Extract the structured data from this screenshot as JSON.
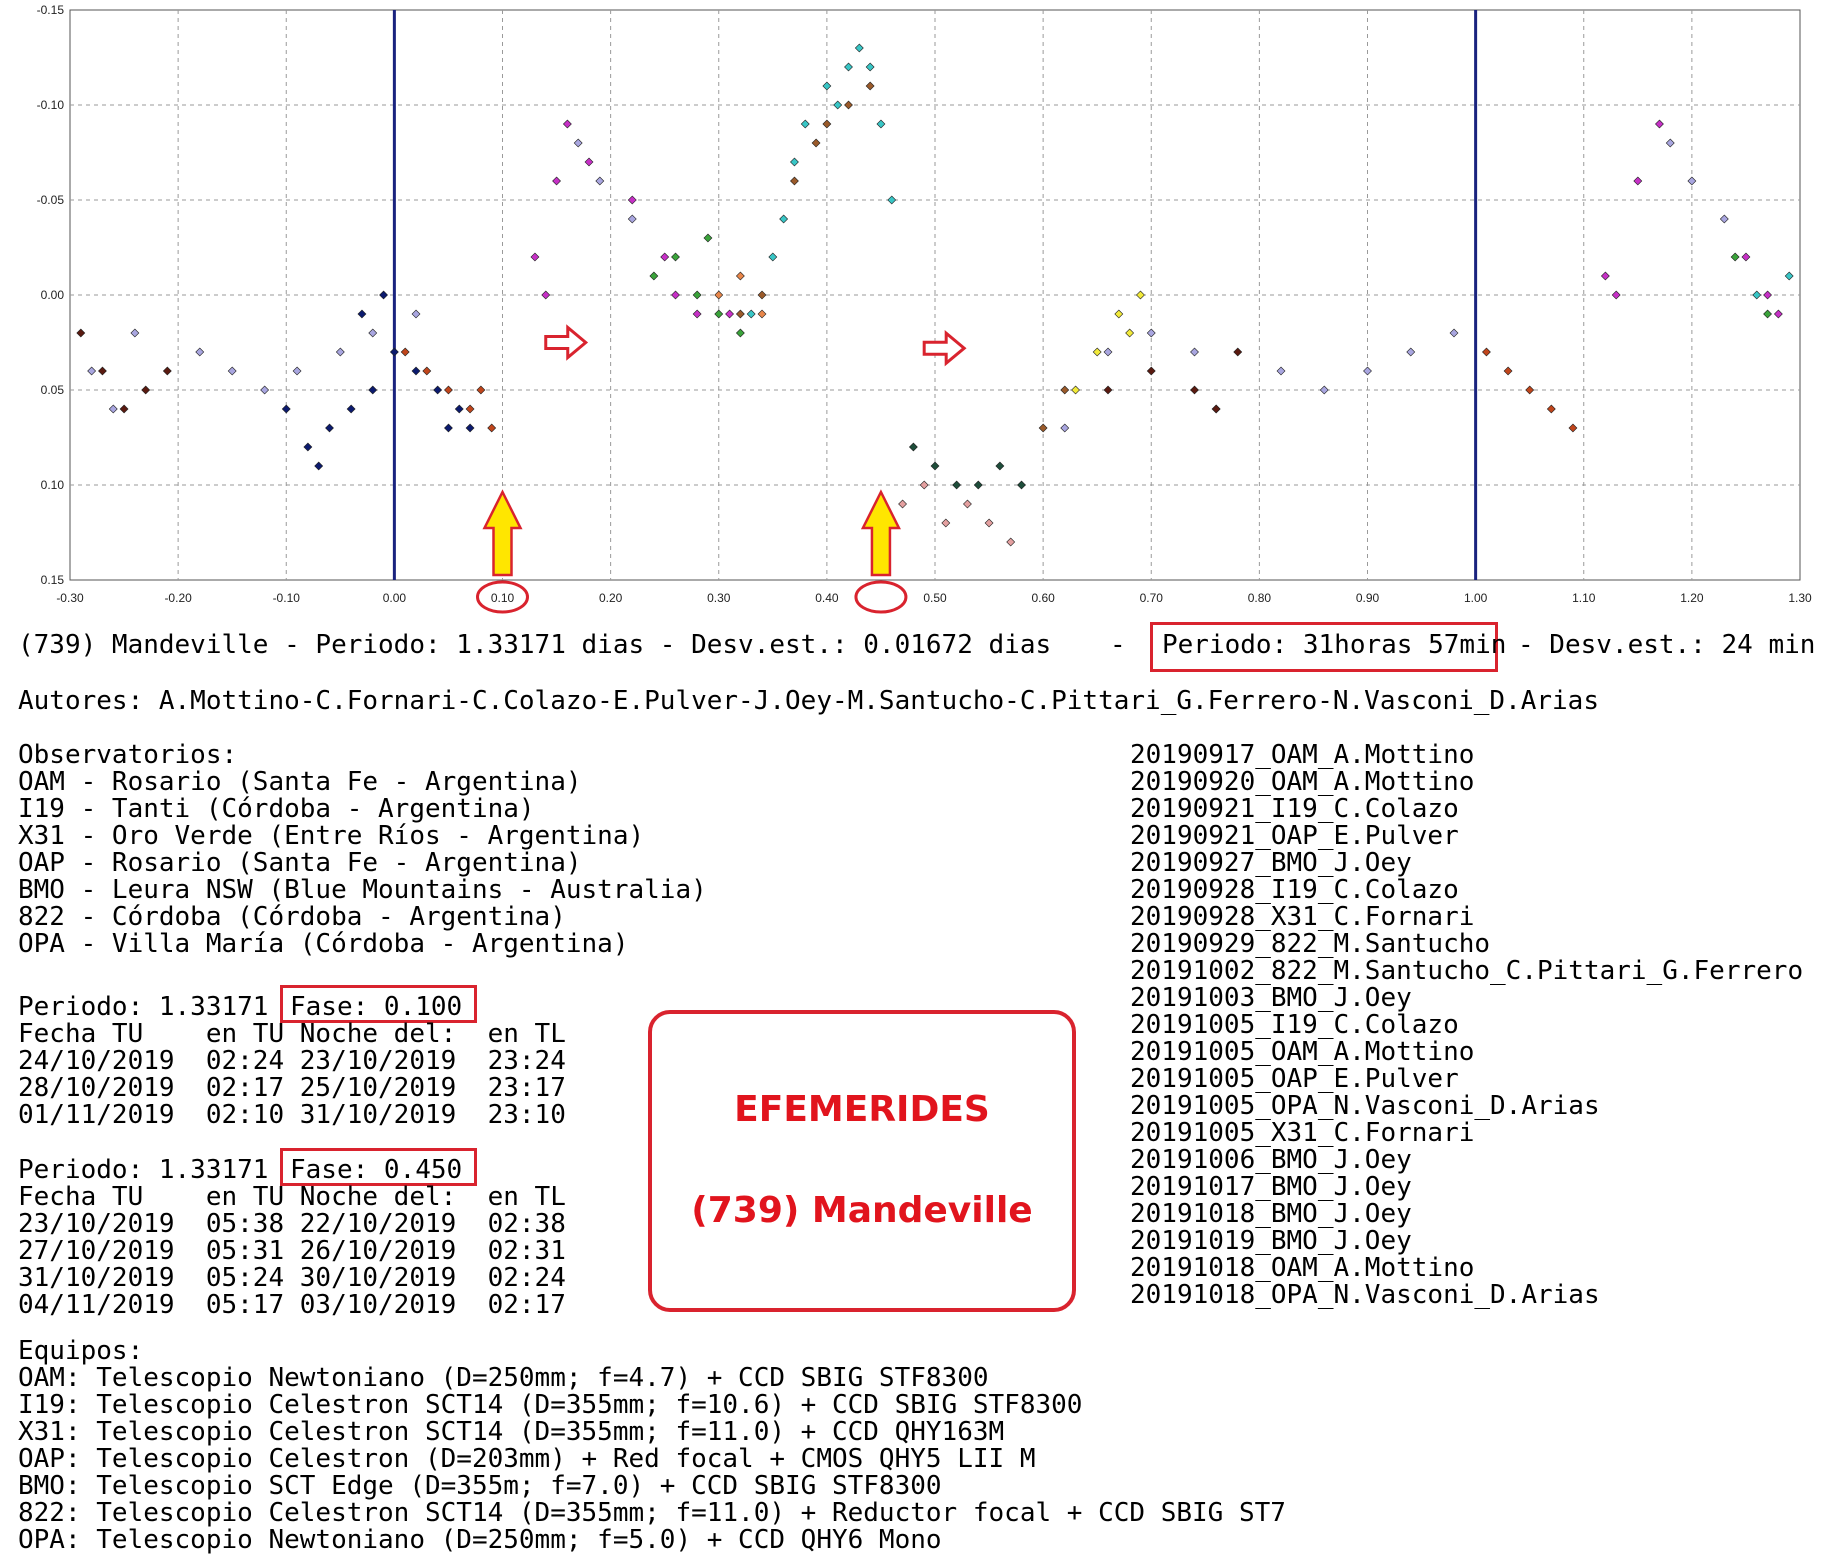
{
  "chart_data": {
    "type": "scatter",
    "title": "",
    "xlabel": "",
    "ylabel": "",
    "xlim": [
      -0.3,
      1.3
    ],
    "ylim": [
      -0.15,
      0.15
    ],
    "y_inverted": true,
    "grid": true,
    "x_tick_labels": [
      "-0.30",
      "-0.20",
      "-0.10",
      "0.00",
      "0.10",
      "0.20",
      "0.30",
      "0.40",
      "0.50",
      "0.60",
      "0.70",
      "0.80",
      "0.90",
      "1.00",
      "1.10",
      "1.20",
      "1.30"
    ],
    "y_tick_labels": [
      "-0.15",
      "-0.10",
      "-0.05",
      "0.00",
      "0.05",
      "0.10",
      "0.15"
    ],
    "x_tick_values": [
      -0.3,
      -0.2,
      -0.1,
      0.0,
      0.1,
      0.2,
      0.3,
      0.4,
      0.5,
      0.6,
      0.7,
      0.8,
      0.9,
      1.0,
      1.1,
      1.2,
      1.3
    ],
    "y_tick_values": [
      -0.15,
      -0.1,
      -0.05,
      0.0,
      0.05,
      0.1,
      0.15
    ],
    "vertical_lines": [
      0.0,
      1.0
    ],
    "circled_ticks": [
      {
        "x": 0.1,
        "label": "0.10"
      },
      {
        "x": 0.45,
        "label": "0.45"
      }
    ],
    "yellow_arrows": [
      0.1,
      0.45
    ],
    "red_arrows": [
      {
        "x": 0.14,
        "y": 0.025
      },
      {
        "x": 0.49,
        "y": 0.028
      }
    ],
    "colors": {
      "navy": "#0b1a6e",
      "lavender": "#a9a6e0",
      "rust": "#c0451b",
      "maroon": "#5a1a10",
      "magenta": "#c630c6",
      "teal": "#38c6c6",
      "green": "#3aa33a",
      "darkgreen": "#1e4d3a",
      "pink": "#e4a0a0",
      "yellow": "#f2ea3a",
      "brown": "#9a5a2a",
      "orange": "#e8864a"
    },
    "series": [
      {
        "color": "navy",
        "points": [
          [
            -0.08,
            0.08
          ],
          [
            -0.06,
            0.07
          ],
          [
            -0.04,
            0.06
          ],
          [
            -0.02,
            0.05
          ],
          [
            0.0,
            0.03
          ],
          [
            0.02,
            0.04
          ],
          [
            0.04,
            0.05
          ],
          [
            0.05,
            0.07
          ],
          [
            -0.1,
            0.06
          ],
          [
            -0.07,
            0.09
          ],
          [
            -0.03,
            0.01
          ],
          [
            -0.01,
            0.0
          ],
          [
            0.06,
            0.06
          ],
          [
            0.07,
            0.07
          ]
        ]
      },
      {
        "color": "lavender",
        "points": [
          [
            -0.28,
            0.04
          ],
          [
            -0.26,
            0.06
          ],
          [
            -0.24,
            0.02
          ],
          [
            -0.18,
            0.03
          ],
          [
            -0.15,
            0.04
          ],
          [
            -0.12,
            0.05
          ],
          [
            -0.09,
            0.04
          ],
          [
            -0.05,
            0.03
          ],
          [
            -0.02,
            0.02
          ],
          [
            0.02,
            0.01
          ],
          [
            0.17,
            -0.08
          ],
          [
            0.19,
            -0.06
          ],
          [
            0.22,
            -0.04
          ],
          [
            0.62,
            0.07
          ],
          [
            0.66,
            0.03
          ],
          [
            0.7,
            0.02
          ],
          [
            0.74,
            0.03
          ],
          [
            0.76,
            0.06
          ],
          [
            0.82,
            0.04
          ],
          [
            0.86,
            0.05
          ],
          [
            0.9,
            0.04
          ],
          [
            0.94,
            0.03
          ],
          [
            0.98,
            0.02
          ],
          [
            1.18,
            -0.08
          ],
          [
            1.2,
            -0.06
          ],
          [
            1.23,
            -0.04
          ]
        ]
      },
      {
        "color": "rust",
        "points": [
          [
            0.01,
            0.03
          ],
          [
            0.03,
            0.04
          ],
          [
            0.05,
            0.05
          ],
          [
            0.07,
            0.06
          ],
          [
            0.08,
            0.05
          ],
          [
            0.09,
            0.07
          ],
          [
            1.01,
            0.03
          ],
          [
            1.03,
            0.04
          ],
          [
            1.05,
            0.05
          ],
          [
            1.07,
            0.06
          ],
          [
            1.09,
            0.07
          ]
        ]
      },
      {
        "color": "maroon",
        "points": [
          [
            -0.29,
            0.02
          ],
          [
            -0.27,
            0.04
          ],
          [
            -0.25,
            0.06
          ],
          [
            -0.23,
            0.05
          ],
          [
            -0.21,
            0.04
          ],
          [
            0.66,
            0.05
          ],
          [
            0.7,
            0.04
          ],
          [
            0.74,
            0.05
          ],
          [
            0.76,
            0.06
          ],
          [
            0.78,
            0.03
          ]
        ]
      },
      {
        "color": "magenta",
        "points": [
          [
            0.13,
            -0.02
          ],
          [
            0.14,
            0.0
          ],
          [
            0.15,
            -0.06
          ],
          [
            0.16,
            -0.09
          ],
          [
            0.18,
            -0.07
          ],
          [
            0.22,
            -0.05
          ],
          [
            0.25,
            -0.02
          ],
          [
            0.26,
            0.0
          ],
          [
            0.28,
            0.01
          ],
          [
            0.31,
            0.01
          ],
          [
            1.12,
            -0.01
          ],
          [
            1.13,
            0.0
          ],
          [
            1.15,
            -0.06
          ],
          [
            1.17,
            -0.09
          ],
          [
            1.25,
            -0.02
          ],
          [
            1.27,
            0.0
          ],
          [
            1.28,
            0.01
          ]
        ]
      },
      {
        "color": "teal",
        "points": [
          [
            0.36,
            -0.04
          ],
          [
            0.37,
            -0.07
          ],
          [
            0.38,
            -0.09
          ],
          [
            0.4,
            -0.11
          ],
          [
            0.41,
            -0.1
          ],
          [
            0.42,
            -0.12
          ],
          [
            0.43,
            -0.13
          ],
          [
            0.44,
            -0.12
          ],
          [
            0.45,
            -0.09
          ],
          [
            0.46,
            -0.05
          ],
          [
            0.33,
            0.01
          ],
          [
            0.35,
            -0.02
          ],
          [
            1.26,
            0.0
          ],
          [
            1.29,
            -0.01
          ]
        ]
      },
      {
        "color": "green",
        "points": [
          [
            0.24,
            -0.01
          ],
          [
            0.26,
            -0.02
          ],
          [
            0.28,
            0.0
          ],
          [
            0.3,
            0.01
          ],
          [
            0.32,
            0.02
          ],
          [
            0.29,
            -0.03
          ],
          [
            1.24,
            -0.02
          ],
          [
            1.27,
            0.01
          ]
        ]
      },
      {
        "color": "darkgreen",
        "points": [
          [
            0.48,
            0.08
          ],
          [
            0.5,
            0.09
          ],
          [
            0.52,
            0.1
          ],
          [
            0.54,
            0.1
          ],
          [
            0.56,
            0.09
          ],
          [
            0.58,
            0.1
          ]
        ]
      },
      {
        "color": "pink",
        "points": [
          [
            0.49,
            0.1
          ],
          [
            0.51,
            0.12
          ],
          [
            0.53,
            0.11
          ],
          [
            0.55,
            0.12
          ],
          [
            0.57,
            0.13
          ],
          [
            0.47,
            0.11
          ]
        ]
      },
      {
        "color": "yellow",
        "points": [
          [
            0.63,
            0.05
          ],
          [
            0.65,
            0.03
          ],
          [
            0.67,
            0.01
          ],
          [
            0.69,
            0.0
          ],
          [
            0.68,
            0.02
          ]
        ]
      },
      {
        "color": "brown",
        "points": [
          [
            0.37,
            -0.06
          ],
          [
            0.39,
            -0.08
          ],
          [
            0.4,
            -0.09
          ],
          [
            0.42,
            -0.1
          ],
          [
            0.44,
            -0.11
          ],
          [
            0.32,
            0.01
          ],
          [
            0.34,
            0.0
          ],
          [
            0.6,
            0.07
          ],
          [
            0.62,
            0.05
          ]
        ]
      },
      {
        "color": "orange",
        "points": [
          [
            0.3,
            0.0
          ],
          [
            0.32,
            -0.01
          ],
          [
            0.34,
            0.01
          ]
        ]
      }
    ]
  },
  "info": {
    "period_line": "(739) Mandeville - Periodo: 1.33171 dias - Desv.est.: 0.01672 dias",
    "period_dash": "-",
    "period_hours": "Periodo: 31horas 57min",
    "period_std": "- Desv.est.: 24 min",
    "authors": "Autores: A.Mottino-C.Fornari-C.Colazo-E.Pulver-J.Oey-M.Santucho-C.Pittari_G.Ferrero-N.Vasconi_D.Arias"
  },
  "observatorios": {
    "heading": "Observatorios:",
    "items": [
      "OAM - Rosario (Santa Fe - Argentina)",
      "I19 - Tanti (Córdoba - Argentina)",
      "X31 - Oro Verde (Entre Ríos - Argentina)",
      "OAP - Rosario (Santa Fe - Argentina)",
      "BMO - Leura NSW (Blue Mountains - Australia)",
      "822 - Córdoba (Córdoba - Argentina)",
      "OPA - Villa María (Córdoba - Argentina)"
    ]
  },
  "phase1": {
    "period": "Periodo: 1.33171",
    "fase": "Fase: 0.100",
    "header": "Fecha TU    en TU Noche del:  en TL",
    "rows": [
      "24/10/2019  02:24 23/10/2019  23:24",
      "28/10/2019  02:17 25/10/2019  23:17",
      "01/11/2019  02:10 31/10/2019  23:10"
    ]
  },
  "phase2": {
    "period": "Periodo: 1.33171",
    "fase": "Fase: 0.450",
    "header": "Fecha TU    en TU Noche del:  en TL",
    "rows": [
      "23/10/2019  05:38 22/10/2019  02:38",
      "27/10/2019  05:31 26/10/2019  02:31",
      "31/10/2019  05:24 30/10/2019  02:24",
      "04/11/2019  05:17 03/10/2019  02:17"
    ]
  },
  "efemerides": {
    "title": "EFEMERIDES",
    "subtitle": "(739) Mandeville"
  },
  "sessions": [
    "20190917_OAM_A.Mottino",
    "20190920_OAM_A.Mottino",
    "20190921_I19_C.Colazo",
    "20190921_OAP_E.Pulver",
    "20190927_BMO_J.Oey",
    "20190928_I19_C.Colazo",
    "20190928_X31_C.Fornari",
    "20190929_822_M.Santucho",
    "20191002_822_M.Santucho_C.Pittari_G.Ferrero",
    "20191003_BMO_J.Oey",
    "20191005_I19_C.Colazo",
    "20191005_OAM_A.Mottino",
    "20191005_OAP_E.Pulver",
    "20191005_OPA_N.Vasconi_D.Arias",
    "20191005_X31_C.Fornari",
    "20191006_BMO_J.Oey",
    "20191017_BMO_J.Oey",
    "20191018_BMO_J.Oey",
    "20191019_BMO_J.Oey",
    "20191018_OAM_A.Mottino",
    "20191018_OPA_N.Vasconi_D.Arias"
  ],
  "equipos": {
    "heading": "Equipos:",
    "items": [
      "OAM: Telescopio Newtoniano (D=250mm; f=4.7) + CCD SBIG STF8300",
      "I19: Telescopio Celestron SCT14 (D=355mm; f=10.6) + CCD SBIG STF8300",
      "X31: Telescopio Celestron SCT14 (D=355mm; f=11.0) + CCD QHY163M",
      "OAP: Telescopio Celestron (D=203mm) + Red focal + CMOS QHY5 LII M",
      "BMO: Telescopio SCT Edge (D=355m; f=7.0) + CCD SBIG STF8300",
      "822: Telescopio Celestron SCT14 (D=355mm; f=11.0) + Reductor focal + CCD SBIG ST7",
      "OPA: Telescopio Newtoniano (D=250mm; f=5.0) + CCD QHY6 Mono"
    ]
  }
}
